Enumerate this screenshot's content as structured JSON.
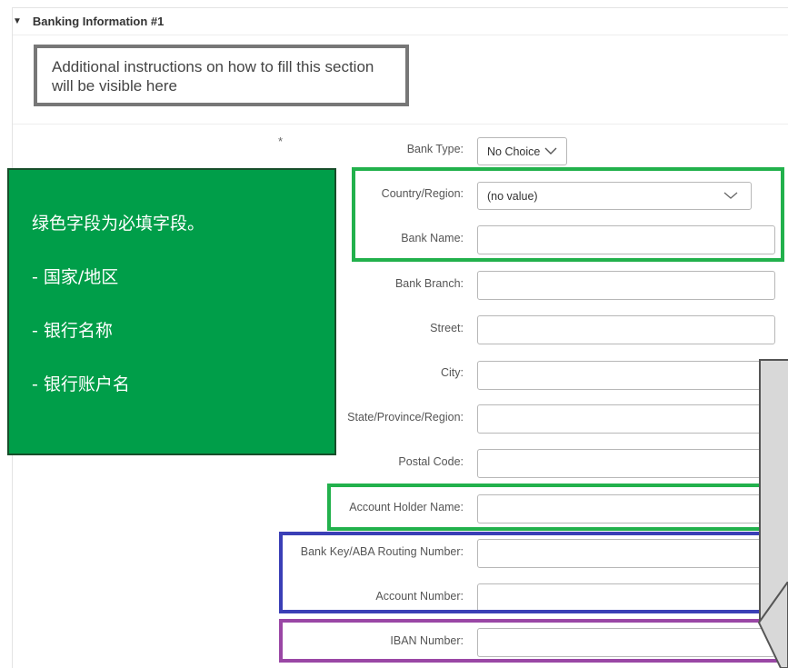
{
  "section": {
    "title": "Banking Information #1"
  },
  "instructions": {
    "text": "Additional instructions on how to fill this section will be visible here"
  },
  "required_marker": "*",
  "note": {
    "heading": "绿色字段为必填字段。",
    "items": [
      "- 国家/地区",
      "- 银行名称",
      "- 银行账户名"
    ]
  },
  "fields": {
    "bank_type": {
      "label": "Bank Type:",
      "value": "No Choice"
    },
    "country": {
      "label": "Country/Region:",
      "value": "(no value)"
    },
    "bank_name": {
      "label": "Bank Name:",
      "value": ""
    },
    "bank_branch": {
      "label": "Bank Branch:",
      "value": ""
    },
    "street": {
      "label": "Street:",
      "value": ""
    },
    "city": {
      "label": "City:",
      "value": ""
    },
    "state": {
      "label": "State/Province/Region:",
      "value": ""
    },
    "postal_code": {
      "label": "Postal Code:",
      "value": ""
    },
    "account_holder": {
      "label": "Account Holder Name:",
      "value": ""
    },
    "bank_key": {
      "label": "Bank Key/ABA Routing Number:",
      "value": ""
    },
    "account_number": {
      "label": "Account Number:",
      "value": ""
    },
    "iban": {
      "label": "IBAN Number:",
      "value": ""
    }
  },
  "colors": {
    "required_highlight": "#22b14c",
    "bank_key_highlight": "#3a3fb6",
    "iban_highlight": "#9a47a5",
    "note_background": "#009e49"
  }
}
